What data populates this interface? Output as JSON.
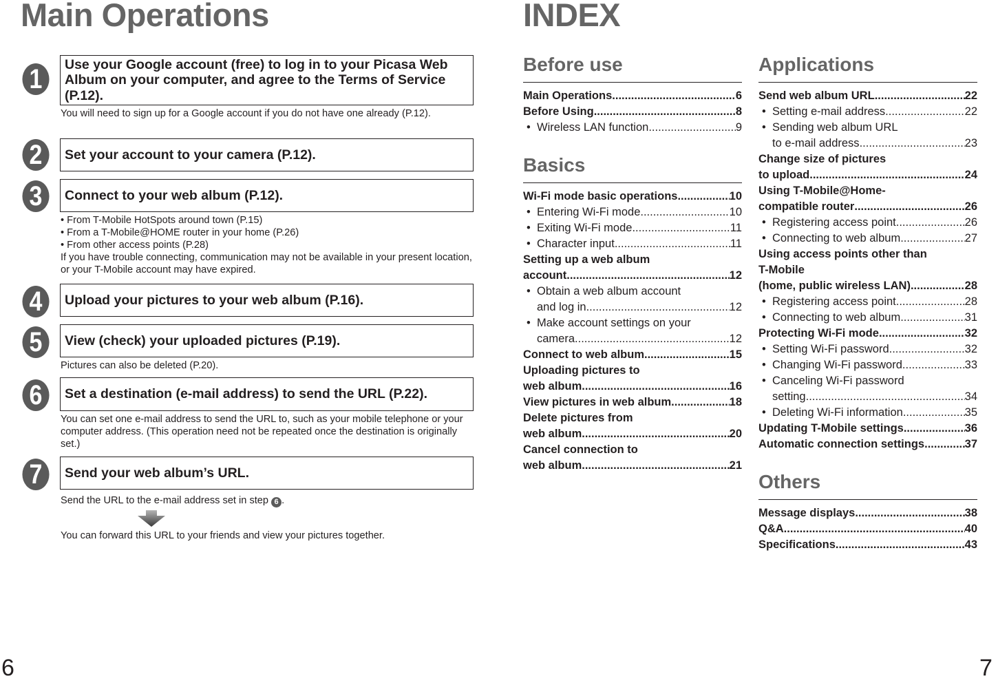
{
  "left_page": {
    "title": "Main Operations",
    "page_number": "6",
    "steps": [
      {
        "num": "1",
        "text": "Use your Google account (free) to log in to your Picasa Web Album on your computer, and agree to the Terms of Service (P.12).",
        "note": "You will need to sign up for a Google account if you do not have one already (P.12)."
      },
      {
        "num": "2",
        "text": "Set your account to your camera (P.12)."
      },
      {
        "num": "3",
        "text": "Connect to your web album (P.12).",
        "bullets": [
          "From T-Mobile HotSpots around town (P.15)",
          "From a T-Mobile@HOME router in your home (P.26)",
          "From other access points (P.28)"
        ],
        "note": "If you have trouble connecting, communication may not be available in your present location, or your T-Mobile account may have expired."
      },
      {
        "num": "4",
        "text": "Upload your pictures to your web album (P.16)."
      },
      {
        "num": "5",
        "text": "View (check) your uploaded pictures (P.19).",
        "note": "Pictures can also be deleted (P.20)."
      },
      {
        "num": "6",
        "text": "Set a destination (e-mail address) to send the URL (P.22).",
        "note": "You can set one e-mail address to send the URL to, such as your mobile telephone or your computer address. (This operation need not be repeated once the destination is originally set.)"
      },
      {
        "num": "7",
        "text": "Send your web album’s URL.",
        "note_prefix": "Send the URL to the e-mail address set in step ",
        "note_ref": "6",
        "note_suffix": ".",
        "note2": "You can forward this URL to your friends and view your pictures together."
      }
    ]
  },
  "right_page": {
    "title": "INDEX",
    "page_number": "7",
    "sections": {
      "before_use": {
        "title": "Before use",
        "entries": [
          {
            "label": "Main Operations ",
            "page": "6",
            "bold": true
          },
          {
            "label": "Before Using ",
            "page": "8",
            "bold": true
          },
          {
            "label": "Wireless LAN function ",
            "page": "9",
            "sub": true
          }
        ]
      },
      "basics": {
        "title": "Basics",
        "entries": [
          {
            "label": "Wi-Fi mode basic operations",
            "page": "10",
            "bold": true
          },
          {
            "label": "Entering Wi-Fi mode",
            "page": "10",
            "sub": true
          },
          {
            "label": "Exiting Wi-Fi mode  ",
            "page": "11",
            "sub": true
          },
          {
            "label": "Character input",
            "page": "11",
            "sub": true
          },
          {
            "label_line1": "Setting up a web album",
            "label": "account",
            "page": "12",
            "bold": true
          },
          {
            "label_line1": "Obtain a web album account",
            "label": "and log in",
            "page": "12",
            "sub": true
          },
          {
            "label_line1": "Make account settings on your",
            "label": "camera",
            "page": "12",
            "sub": true
          },
          {
            "label": "Connect to web album ",
            "page": "15",
            "bold": true
          },
          {
            "label_line1": "Uploading pictures to",
            "label": "web album",
            "page": "16",
            "bold": true
          },
          {
            "label": "View pictures in web album",
            "page": "18",
            "bold": true
          },
          {
            "label_line1": "Delete pictures from",
            "label": "web album",
            "page": "20",
            "bold": true
          },
          {
            "label_line1": "Cancel connection to",
            "label": "web album",
            "page": "21",
            "bold": true
          }
        ]
      },
      "applications": {
        "title": "Applications",
        "entries": [
          {
            "label": "Send web album URL",
            "page": "22",
            "bold": true
          },
          {
            "label": "Setting e-mail address",
            "page": "22",
            "sub": true
          },
          {
            "label_line1": "Sending web album URL",
            "label": "to e-mail address",
            "page": "23",
            "sub": true
          },
          {
            "label_line1": "Change size of pictures",
            "label": "to upload ",
            "page": "24",
            "bold": true
          },
          {
            "label_line1": "Using T-Mobile@Home-",
            "label": "compatible router ",
            "page": "26",
            "bold": true
          },
          {
            "label": "Registering access point ",
            "page": "26",
            "sub": true
          },
          {
            "label": "Connecting to web album",
            "page": "27",
            "sub": true
          },
          {
            "label_line1": "Using access points other than",
            "label_line2": "T-Mobile",
            "label": "(home, public wireless LAN) ",
            "page": "28",
            "bold": true
          },
          {
            "label": "Registering access point ",
            "page": "28",
            "sub": true
          },
          {
            "label": "Connecting to web album",
            "page": "31",
            "sub": true
          },
          {
            "label": "Protecting Wi-Fi mode ",
            "page": "32",
            "bold": true
          },
          {
            "label": "Setting Wi-Fi password",
            "page": "32",
            "sub": true
          },
          {
            "label": "Changing Wi-Fi password ",
            "page": "33",
            "sub": true
          },
          {
            "label_line1": "Canceling Wi-Fi password",
            "label": "setting",
            "page": "34",
            "sub": true
          },
          {
            "label": "Deleting Wi-Fi information ",
            "page": "35",
            "sub": true
          },
          {
            "label": "Updating T-Mobile settings",
            "page": "36",
            "bold": true
          },
          {
            "label": "Automatic connection settings",
            "page": "37",
            "bold": true
          }
        ]
      },
      "others": {
        "title": "Others",
        "entries": [
          {
            "label": "Message displays",
            "page": "38",
            "bold": true
          },
          {
            "label": "Q&A",
            "page": "40",
            "bold": true
          },
          {
            "label": "Specifications ",
            "page": "43",
            "bold": true
          }
        ]
      }
    }
  },
  "colors": {
    "heading_gray": "#656565",
    "badge_gray": "#5a5a5a",
    "text": "#231f20"
  }
}
